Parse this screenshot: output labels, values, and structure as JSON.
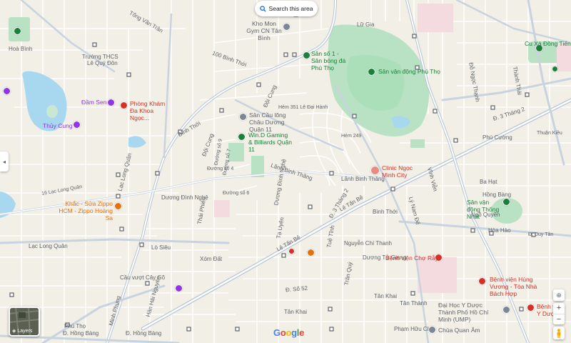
{
  "search_button": {
    "label": "Search this area",
    "icon": "search-icon"
  },
  "layers_button": {
    "label": "Layers",
    "icon": "layers-icon"
  },
  "google_logo": "Google",
  "colors": {
    "road": "#ffffff",
    "major_road": "#b7c4d4",
    "water": "#a8d8f0",
    "park": "#b8e2c3",
    "land": "#f1efe6",
    "hospital": "#d93025",
    "poi_green": "#188038",
    "poi_purple": "#9334e6",
    "poi_orange": "#e8710a"
  },
  "streets": [
    "Tống Văn Trân",
    "Hoà Bình",
    "Trường THCS",
    "Lê Quý Đôn",
    "100 Bình Thới",
    "Hẻm 351 Lê Đại Hành",
    "Bình Thới",
    "Đội Cung",
    "Đường số 9",
    "Đường số 7",
    "Đường số 6",
    "Đường số 4",
    "Đường số 5",
    "Lạc Long Quân",
    "16 Lạc Long Quân",
    "Lãnh Binh Thăng",
    "Lê Đại Hành",
    "Lữ Gia",
    "Lê Tấn Bê",
    "Đ. 3 Tháng 2",
    "Tuệ Tĩnh",
    "Tạ Uyên",
    "Lò Siêu",
    "Xóm Đất",
    "Hàn Hải Nguyên",
    "Minh Phụng",
    "Phú Thọ",
    "Đ. Hồng Bàng",
    "Cầu vượt Cây Gõ",
    "Đ. Số 52",
    "Nguyễn Chí Thanh",
    "Trần Quý",
    "Dương Tử Giang",
    "Tân Khai",
    "Tân Thành",
    "Phạm Hữu Chí",
    "Hồng Bàng",
    "Tân Phước",
    "Phú Cường",
    "Ba Hạt",
    "Vĩnh Viễn",
    "Lý Nam Đế",
    "Lê Đại Hành",
    "Ngô Quyền",
    "Hòa Hảo",
    "Đ. Duy Tân",
    "Trần Bình Trọng",
    "Thuận Kiều",
    "Hẻm 249",
    "Đ. 3 Tháng 2",
    "Hà Tôn Quyền",
    "Tân Hòa",
    "Thái Phiên",
    "Bình Thới",
    "Lê Văn",
    "Dương Đình Nghệ",
    "Xóm Đất",
    "Hoàng Sa",
    "Đỗ Ngọc Thạnh",
    "Hẻm 360",
    "Thành Thái",
    "Đ. Lê Văn Việt"
  ],
  "pois": [
    {
      "name": "Kho Mon Gym CN Tân Bình",
      "kind": "gray"
    },
    {
      "name": "Sân số 1 - Sân bóng đá Phú Thọ",
      "kind": "green"
    },
    {
      "name": "Sân vận động Phú Thọ",
      "kind": "green"
    },
    {
      "name": "Đầm Sen",
      "kind": "purple"
    },
    {
      "name": "Phòng Khám Đa Khoa Ngọc...",
      "kind": "red"
    },
    {
      "name": "Thủy Cung",
      "kind": "purple"
    },
    {
      "name": "Sân Cầu lông Châu Dương Quận 11",
      "kind": "gray"
    },
    {
      "name": "Win.D Gaming & Billiards Quận 11",
      "kind": "green"
    },
    {
      "name": "Clinic Ngọc Minh City",
      "kind": "red"
    },
    {
      "name": "Khắc - Sửa Zippo HCM - Zippo Hoàng Sa",
      "kind": "orange"
    },
    {
      "name": "Sân vận động Thống Nhất",
      "kind": "green"
    },
    {
      "name": "Bệnh viện Chợ Rẫy",
      "kind": "red"
    },
    {
      "name": "Bệnh viện Hùng Vương - Tòa Nhà Bách Hợp",
      "kind": "red"
    },
    {
      "name": "Đại Học Y Dược Thành Phố Hồ Chí Minh (UMP)",
      "kind": "gray"
    },
    {
      "name": "Bệnh viện Y Dược HCM",
      "kind": "red"
    },
    {
      "name": "Chùa Quan Âm",
      "kind": "gray"
    },
    {
      "name": "Cu Xá Đồng Tiến",
      "kind": "green"
    }
  ],
  "controls": {
    "zoom_in": "+",
    "zoom_out": "−",
    "compass": "compass-icon",
    "street_view": "pegman-icon"
  }
}
